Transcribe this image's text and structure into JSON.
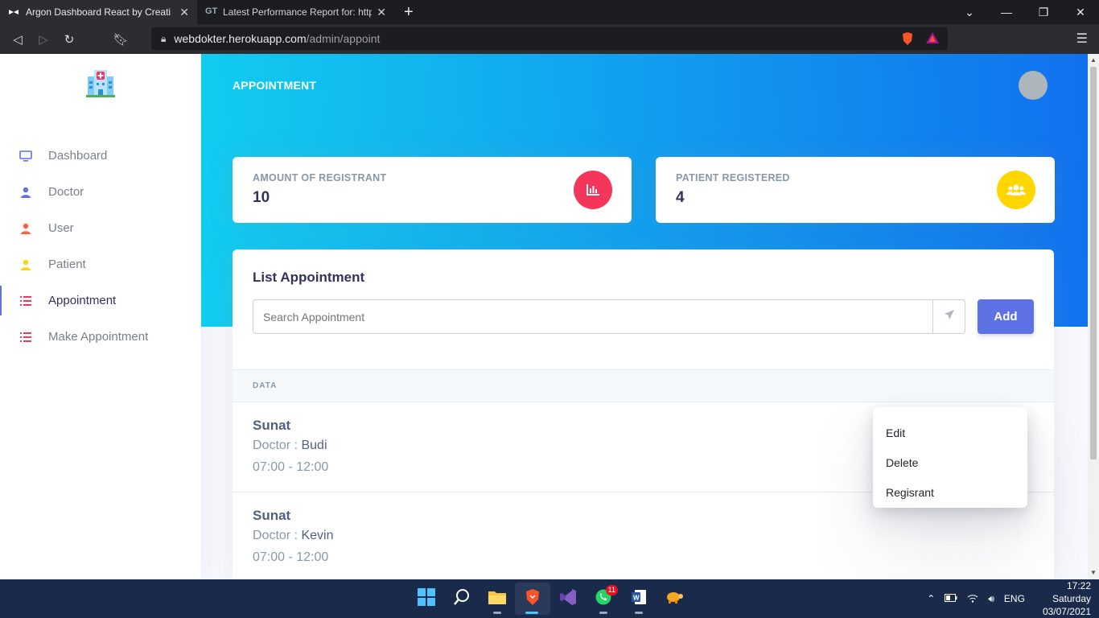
{
  "browser": {
    "tabs": [
      {
        "title": "Argon Dashboard React by Creati",
        "active": true
      },
      {
        "title": "Latest Performance Report for: https://",
        "active": false
      }
    ],
    "url_host": "webdokter.herokuapp.com",
    "url_path": "/admin/appoint"
  },
  "sidebar": {
    "items": [
      {
        "label": "Dashboard",
        "icon": "tv-icon",
        "color": "#5e72e4"
      },
      {
        "label": "Doctor",
        "icon": "user-icon",
        "color": "#5e72e4"
      },
      {
        "label": "User",
        "icon": "user-icon",
        "color": "#fb6340"
      },
      {
        "label": "Patient",
        "icon": "user-icon",
        "color": "#ffd600"
      },
      {
        "label": "Appointment",
        "icon": "list-icon",
        "color": "#f5365c",
        "active": true
      },
      {
        "label": "Make Appointment",
        "icon": "list-icon",
        "color": "#f5365c"
      }
    ]
  },
  "header": {
    "title": "APPOINTMENT"
  },
  "stats": [
    {
      "label": "AMOUNT OF REGISTRANT",
      "value": "10",
      "icon": "chart-bar-icon",
      "color": "#f5365c"
    },
    {
      "label": "PATIENT REGISTERED",
      "value": "4",
      "icon": "users-icon",
      "color": "#ffd600"
    }
  ],
  "list": {
    "title": "List Appointment",
    "search_placeholder": "Search Appointment",
    "add_label": "Add",
    "column_header": "DATA",
    "rows": [
      {
        "name": "Sunat",
        "doctor_prefix": "Doctor : ",
        "doctor": "Budi",
        "time": "07:00 - 12:00"
      },
      {
        "name": "Sunat",
        "doctor_prefix": "Doctor : ",
        "doctor": "Kevin",
        "time": "07:00 - 12:00"
      }
    ]
  },
  "dropdown": {
    "items": [
      "Edit",
      "Delete",
      "Regisrant"
    ]
  },
  "taskbar": {
    "whatsapp_badge": "11",
    "lang": "ENG",
    "time": "17:22",
    "day": "Saturday",
    "date": "03/07/2021"
  }
}
